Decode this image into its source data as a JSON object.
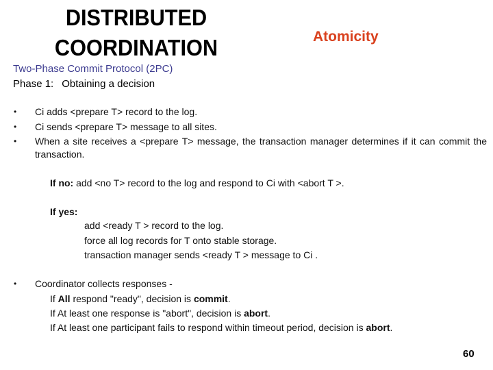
{
  "slide": {
    "title_line1": "DISTRIBUTED",
    "title_line2": "COORDINATION",
    "topic": "Atomicity",
    "protocol_heading": "Two-Phase Commit Protocol (2PC)",
    "phase_label": "Phase 1:",
    "phase_title": "Obtaining a decision",
    "bullet_glyph": "•",
    "bullets": [
      "Ci adds <prepare T> record to the log.",
      "Ci sends <prepare T> message to all sites.",
      "When a site receives a <prepare T> message, the transaction manager determines if it can commit the transaction."
    ],
    "if_no": {
      "label": "If no:",
      "text": " add <no T> record to the log and respond to Ci with <abort T >."
    },
    "if_yes": {
      "label": "If yes:",
      "steps": [
        "add <ready T > record to the log.",
        "force all log records  for T onto stable storage.",
        "transaction manager sends <ready T > message to Ci ."
      ]
    },
    "coordinator": {
      "text": "Coordinator collects responses -",
      "rules": [
        {
          "pre": "If ",
          "bold1": "All",
          "mid": " respond \"ready\", decision is ",
          "bold2": "commit",
          "post": "."
        },
        {
          "pre": "If At least one response is \"abort\", decision is ",
          "bold2": "abort",
          "post": "."
        },
        {
          "pre": "If At least one participant fails to respond within timeout period, decision is ",
          "bold2": "abort",
          "post": "."
        }
      ]
    },
    "page_number": "60",
    "colors": {
      "topic": "#d9411e",
      "protocol_heading": "#3b3a8f"
    }
  }
}
